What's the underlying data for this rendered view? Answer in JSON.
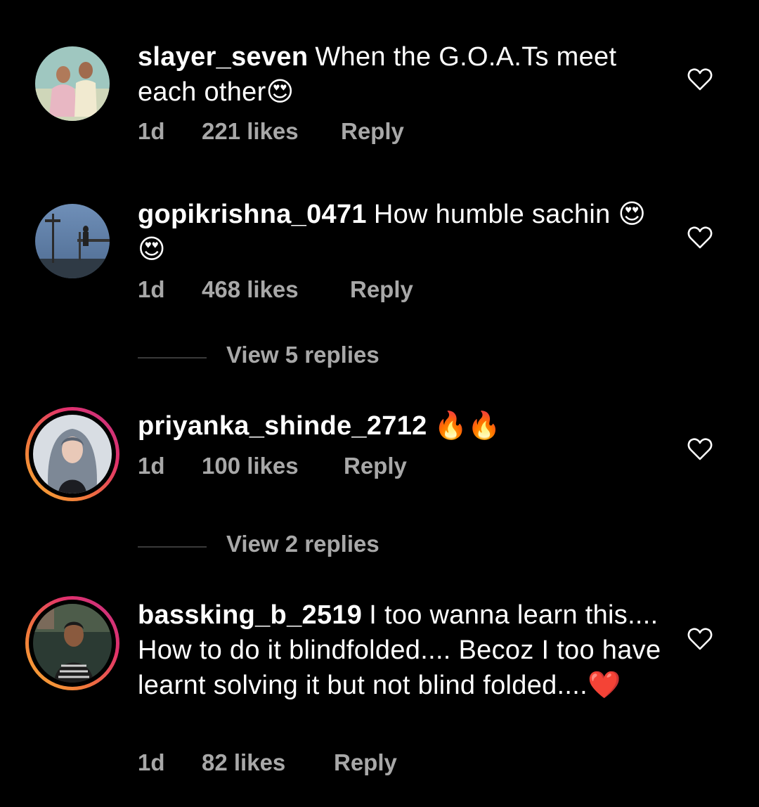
{
  "comments": [
    {
      "username": "slayer_seven",
      "text": "When the G.O.A.Ts meet each other😍",
      "time": "1d",
      "likes": "221 likes",
      "reply": "Reply",
      "has_story_ring": false
    },
    {
      "username": "gopikrishna_0471",
      "text": "How humble sachin 😍😍",
      "time": "1d",
      "likes": "468 likes",
      "reply": "Reply",
      "has_story_ring": false,
      "view_replies": "View 5 replies"
    },
    {
      "username": "priyanka_shinde_2712",
      "text": "🔥🔥",
      "time": "1d",
      "likes": "100 likes",
      "reply": "Reply",
      "has_story_ring": true,
      "view_replies": "View 2 replies"
    },
    {
      "username": "bassking_b_2519",
      "text": "I too wanna learn this.... How to do it blindfolded.... Becoz I too have learnt solving it but not blind folded....❤️",
      "time": "1d",
      "likes": "82 likes",
      "reply": "Reply",
      "has_story_ring": true
    }
  ],
  "colors": {
    "background": "#000000",
    "text": "#ffffff",
    "secondary_text": "#a8a8a8",
    "divider": "#3a3a3a"
  },
  "icons": {
    "like": "heart-outline-icon"
  }
}
